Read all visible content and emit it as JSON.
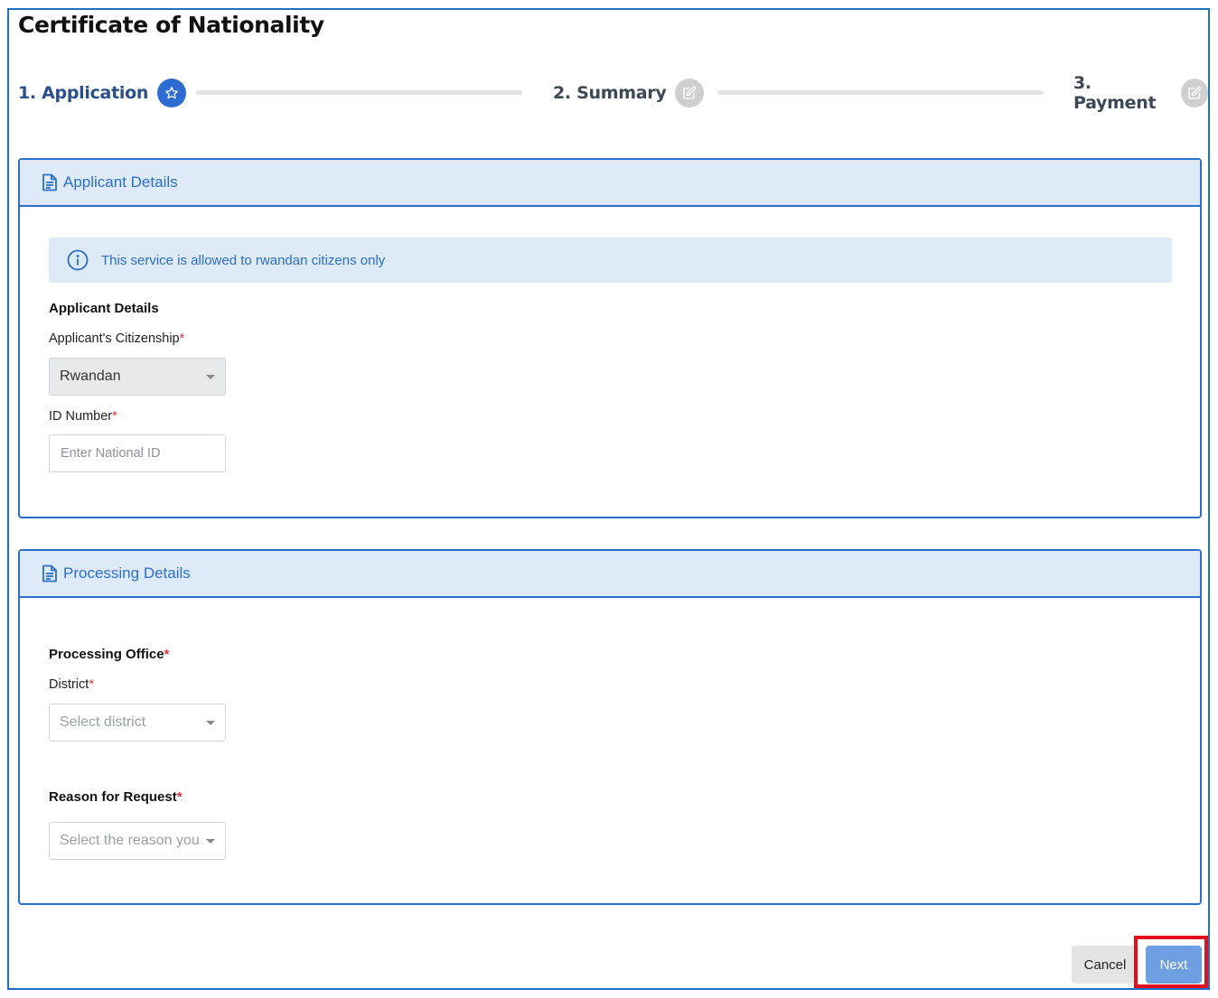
{
  "page_title": "Certificate of Nationality",
  "stepper": {
    "steps": [
      {
        "label": "1. Application",
        "state": "active",
        "icon": "star-icon"
      },
      {
        "label": "2. Summary",
        "state": "inactive",
        "icon": "edit-icon"
      },
      {
        "label": "3. Payment",
        "state": "inactive",
        "icon": "edit-icon"
      }
    ]
  },
  "applicant_card": {
    "header": "Applicant Details",
    "info_message": "This service is allowed to rwandan citizens only",
    "section_heading": "Applicant Details",
    "citizenship": {
      "label": "Applicant's Citizenship",
      "required_mark": "*",
      "value": "Rwandan"
    },
    "id_number": {
      "label": "ID Number",
      "required_mark": "*",
      "placeholder": "Enter National ID"
    }
  },
  "processing_card": {
    "header": "Processing Details",
    "processing_office": {
      "heading": "Processing Office",
      "required_mark": "*"
    },
    "district": {
      "label": "District",
      "required_mark": "*",
      "placeholder": "Select district"
    },
    "reason": {
      "heading": "Reason for Request",
      "required_mark": "*",
      "placeholder": "Select the reason you"
    }
  },
  "actions": {
    "cancel_label": "Cancel",
    "next_label": "Next"
  },
  "colors": {
    "accent": "#2a6fc9",
    "header_bg": "#dfeaf8",
    "required": "#e0333a",
    "highlight": "#e3101b"
  }
}
